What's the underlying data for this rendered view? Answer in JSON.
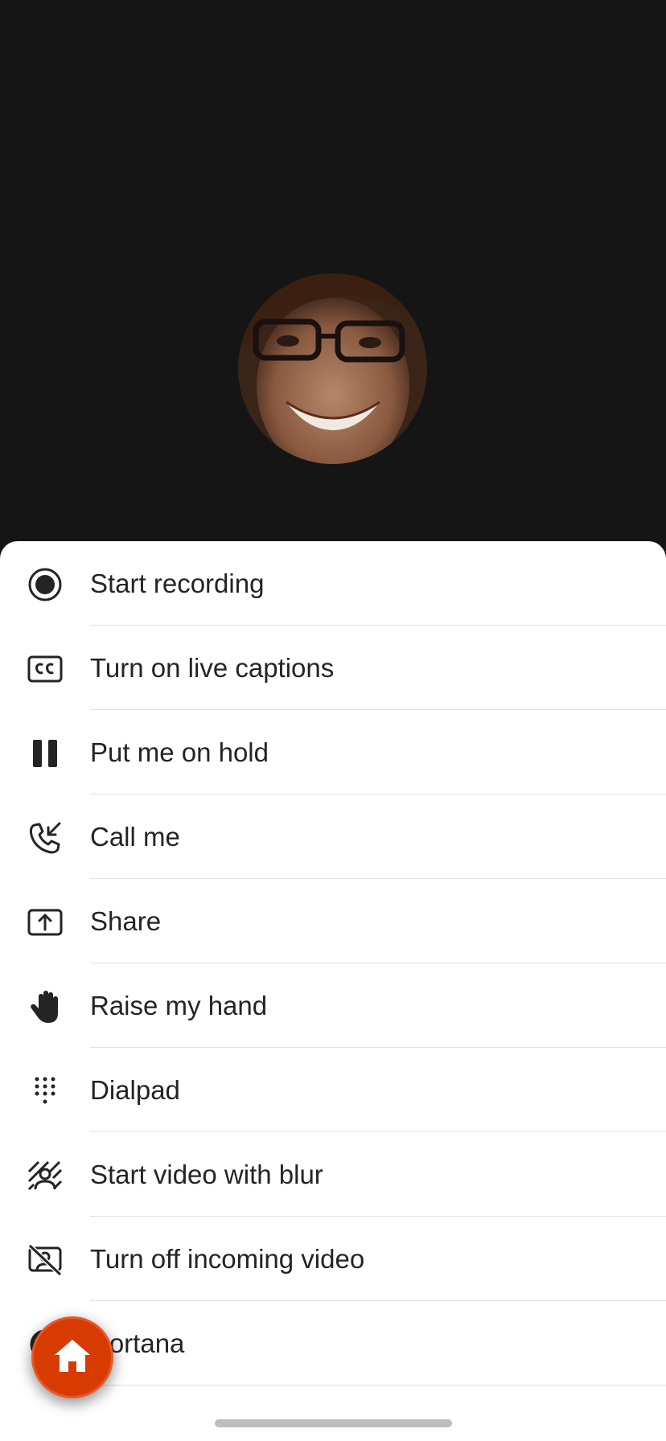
{
  "call": {
    "avatar_alt": "Participant avatar"
  },
  "menu": {
    "items": [
      {
        "label": "Start recording",
        "icon": "record-icon"
      },
      {
        "label": "Turn on live captions",
        "icon": "closed-captions-icon"
      },
      {
        "label": "Put me on hold",
        "icon": "pause-icon"
      },
      {
        "label": "Call me",
        "icon": "incoming-call-icon"
      },
      {
        "label": "Share",
        "icon": "share-screen-icon"
      },
      {
        "label": "Raise my hand",
        "icon": "hand-icon"
      },
      {
        "label": "Dialpad",
        "icon": "dialpad-icon"
      },
      {
        "label": "Start video with blur",
        "icon": "background-blur-icon"
      },
      {
        "label": "Turn off incoming video",
        "icon": "video-off-icon"
      },
      {
        "label": "Cortana",
        "icon": "cortana-icon"
      }
    ]
  },
  "fab": {
    "icon": "home-icon",
    "color": "#d83b01"
  },
  "colors": {
    "background": "#151515",
    "sheet": "#ffffff",
    "text": "#242424"
  }
}
